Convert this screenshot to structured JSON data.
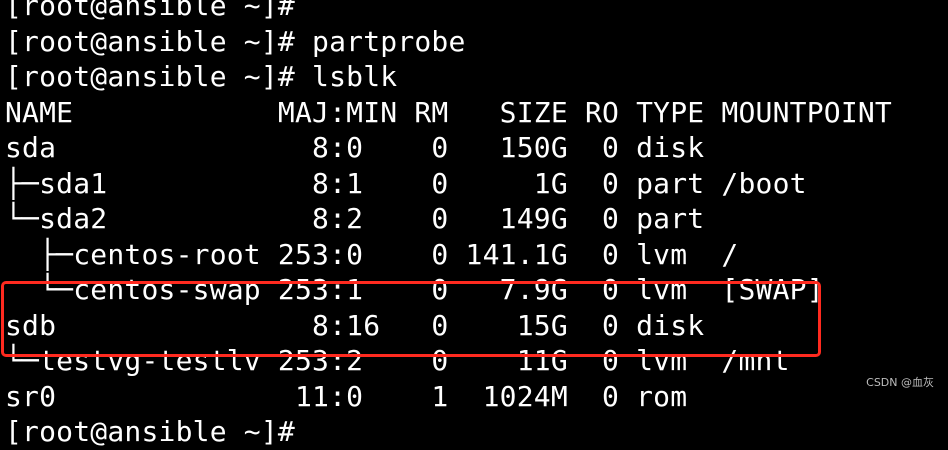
{
  "terminal": {
    "lines": [
      "[root@ansible ~]# ",
      "[root@ansible ~]# partprobe",
      "[root@ansible ~]# lsblk",
      "NAME            MAJ:MIN RM   SIZE RO TYPE MOUNTPOINT",
      "sda               8:0    0   150G  0 disk",
      "├─sda1            8:1    0     1G  0 part /boot",
      "└─sda2            8:2    0   149G  0 part",
      "  ├─centos-root 253:0    0 141.1G  0 lvm  /",
      "  └─centos-swap 253:1    0   7.9G  0 lvm  [SWAP]",
      "sdb               8:16   0    15G  0 disk",
      "└─testvg-testlv 253:2    0    11G  0 lvm  /mnt",
      "sr0              11:0    1  1024M  0 rom",
      "[root@ansible ~]# "
    ]
  },
  "watermark": "CSDN @血灰",
  "colors": {
    "background": "#000000",
    "text": "#ffffff",
    "highlight": "#ff2a1f"
  }
}
